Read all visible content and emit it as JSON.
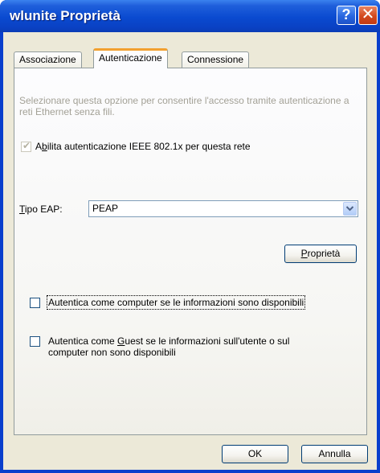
{
  "window": {
    "title": "wlunite Proprietà",
    "help_label": "?",
    "close_label": "✕"
  },
  "tabs": [
    {
      "label": "Associazione",
      "active": false
    },
    {
      "label": "Autenticazione",
      "active": true
    },
    {
      "label": "Connessione",
      "active": false
    }
  ],
  "auth": {
    "description": "Selezionare questa opzione per consentire l'accesso tramite autenticazione a reti Ethernet senza fili.",
    "enable_8021x": {
      "pre": "A",
      "key": "b",
      "post": "ilita autenticazione IEEE 802.1x per questa rete",
      "checked": true,
      "enabled": false
    },
    "eap_type_label": {
      "key": "T",
      "post": "ipo EAP:"
    },
    "eap_type_value": "PEAP",
    "properties_button": {
      "key": "P",
      "post": "roprietà"
    },
    "computer_auth": {
      "text": "Autentica come computer se le informazioni sono disponibili",
      "checked": false
    },
    "guest_auth": {
      "pre": "Autentica come ",
      "key": "G",
      "post": "uest se le informazioni sull'utente o sul",
      "line2": "computer non sono disponibili",
      "checked": false
    }
  },
  "footer": {
    "ok_label": "OK",
    "cancel_label": "Annulla"
  }
}
